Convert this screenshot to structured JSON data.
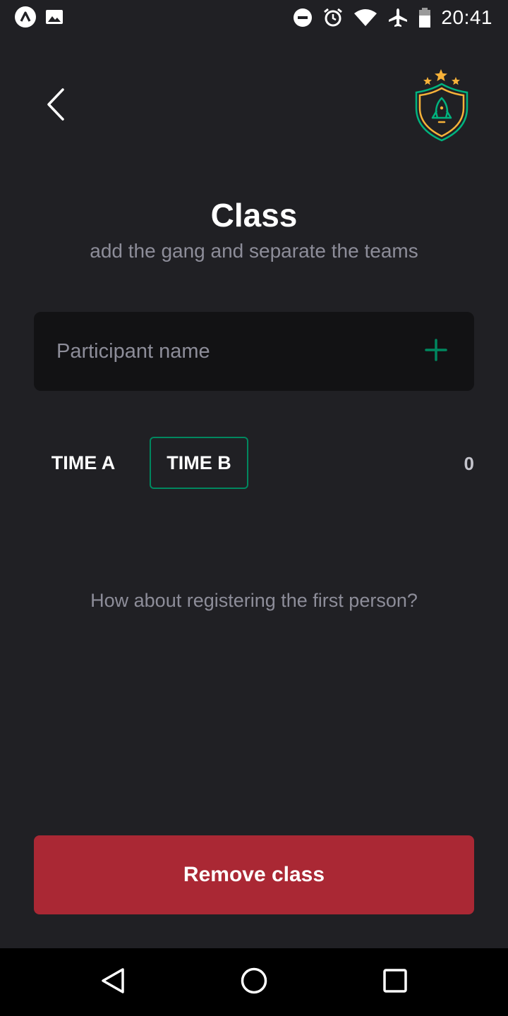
{
  "status_bar": {
    "time": "20:41",
    "icons": [
      "app-notification-icon",
      "image-notification-icon",
      "do-not-disturb-icon",
      "alarm-icon",
      "wifi-icon",
      "airplane-mode-icon",
      "battery-icon"
    ]
  },
  "header": {
    "back_icon": "chevron-left-icon",
    "logo_icon": "rocket-shield-logo"
  },
  "page": {
    "title": "Class",
    "subtitle": "add the gang and separate the teams"
  },
  "participant_input": {
    "placeholder": "Participant name",
    "value": "",
    "add_icon": "plus-icon"
  },
  "tabs": [
    {
      "label": "TIME A",
      "selected": false
    },
    {
      "label": "TIME B",
      "selected": true
    }
  ],
  "participants_count": "0",
  "empty_state": "How about registering the first person?",
  "remove_button": {
    "label": "Remove class"
  },
  "colors": {
    "background": "#202024",
    "input_background": "#121214",
    "accent_green": "#00875f",
    "danger_red": "#aa2834",
    "muted_text": "#8d8d99",
    "logo_orange": "#f7b239"
  },
  "nav_bar": {
    "icons": [
      "back-triangle-icon",
      "home-circle-icon",
      "recents-square-icon"
    ]
  }
}
